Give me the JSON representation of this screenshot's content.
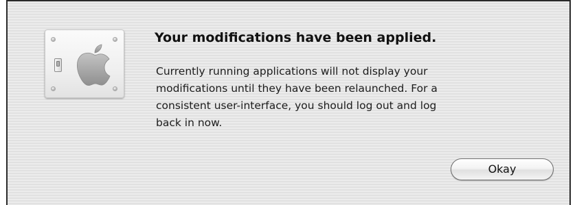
{
  "dialog": {
    "icon": "apple-switch-panel-icon",
    "title": "Your modifications have been applied.",
    "message_lines": [
      "Currently running applications will not display your",
      "modifications until they have been relaunched.  For a",
      "consistent user-interface, you should log out and log",
      "back in now."
    ],
    "okay_label": "Okay"
  },
  "colors": {
    "background": "#e6e6e6",
    "border": "#2a2a2a",
    "text": "#111111"
  }
}
